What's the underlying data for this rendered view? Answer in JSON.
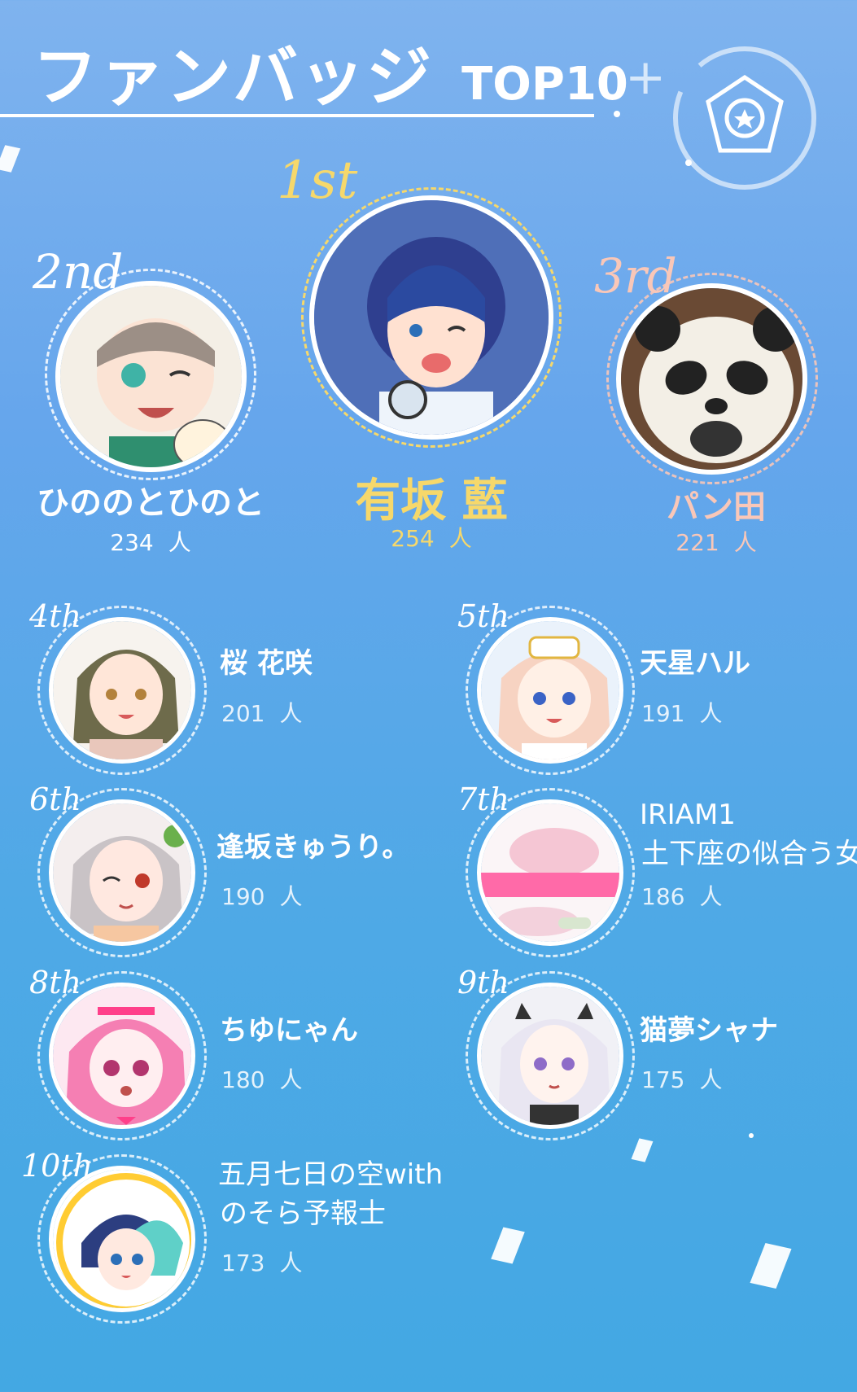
{
  "header": {
    "title_jp": "ファンバッジ",
    "title_en": "TOP10",
    "badge_icon": "star-badge-icon"
  },
  "unit": "人",
  "colors": {
    "gold": "#f6d86b",
    "silver": "#ffffff",
    "bronze": "#f9c7b8",
    "background_top": "#7fb3ee",
    "background_bottom": "#43a8e3"
  },
  "podium": [
    {
      "rank": "1st",
      "name": "有坂 藍",
      "count": "254"
    },
    {
      "rank": "2nd",
      "name": "ひののとひのと",
      "count": "234"
    },
    {
      "rank": "3rd",
      "name": "パン田",
      "count": "221"
    }
  ],
  "ranks": [
    {
      "rank": "4th",
      "name": "桜 花咲",
      "count": "201"
    },
    {
      "rank": "5th",
      "name": "天星ハル",
      "count": "191"
    },
    {
      "rank": "6th",
      "name": "逢坂きゅうり。",
      "count": "190"
    },
    {
      "rank": "7th",
      "name_line1": "IRIAM1",
      "name_line2": "土下座の似合う女",
      "count": "186"
    },
    {
      "rank": "8th",
      "name": "ちゆにゃん",
      "count": "180"
    },
    {
      "rank": "9th",
      "name": "猫夢シャナ",
      "count": "175"
    },
    {
      "rank": "10th",
      "name_line1": "五月七日の空with",
      "name_line2": "のそら予報士",
      "count": "173"
    }
  ]
}
